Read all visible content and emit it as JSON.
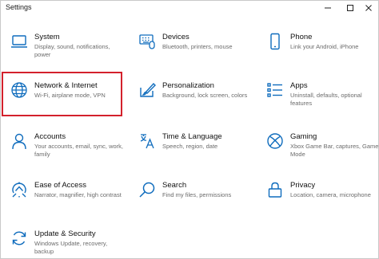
{
  "window": {
    "title": "Settings",
    "controls": [
      "minimize-icon",
      "maximize-icon",
      "close-icon"
    ]
  },
  "accent_color": "#0f6cbd",
  "highlight_color": "#d3212c",
  "tiles": [
    {
      "name": "System",
      "desc": "Display, sound, notifications, power",
      "icon": "laptop-icon"
    },
    {
      "name": "Devices",
      "desc": "Bluetooth, printers, mouse",
      "icon": "keyboard-icon"
    },
    {
      "name": "Phone",
      "desc": "Link your Android, iPhone",
      "icon": "phone-icon"
    },
    {
      "name": "Network & Internet",
      "desc": "Wi-Fi, airplane mode, VPN",
      "icon": "globe-icon",
      "highlighted": true
    },
    {
      "name": "Personalization",
      "desc": "Background, lock screen, colors",
      "icon": "paint-brush-icon"
    },
    {
      "name": "Apps",
      "desc": "Uninstall, defaults, optional features",
      "icon": "apps-list-icon"
    },
    {
      "name": "Accounts",
      "desc": "Your accounts, email, sync, work, family",
      "icon": "person-icon"
    },
    {
      "name": "Time & Language",
      "desc": "Speech, region, date",
      "icon": "time-language-icon"
    },
    {
      "name": "Gaming",
      "desc": "Xbox Game Bar, captures, Game Mode",
      "icon": "xbox-icon"
    },
    {
      "name": "Ease of Access",
      "desc": "Narrator, magnifier, high contrast",
      "icon": "ease-of-access-icon"
    },
    {
      "name": "Search",
      "desc": "Find my files, permissions",
      "icon": "search-icon"
    },
    {
      "name": "Privacy",
      "desc": "Location, camera, microphone",
      "icon": "lock-icon"
    },
    {
      "name": "Update & Security",
      "desc": "Windows Update, recovery, backup",
      "icon": "sync-icon"
    }
  ]
}
